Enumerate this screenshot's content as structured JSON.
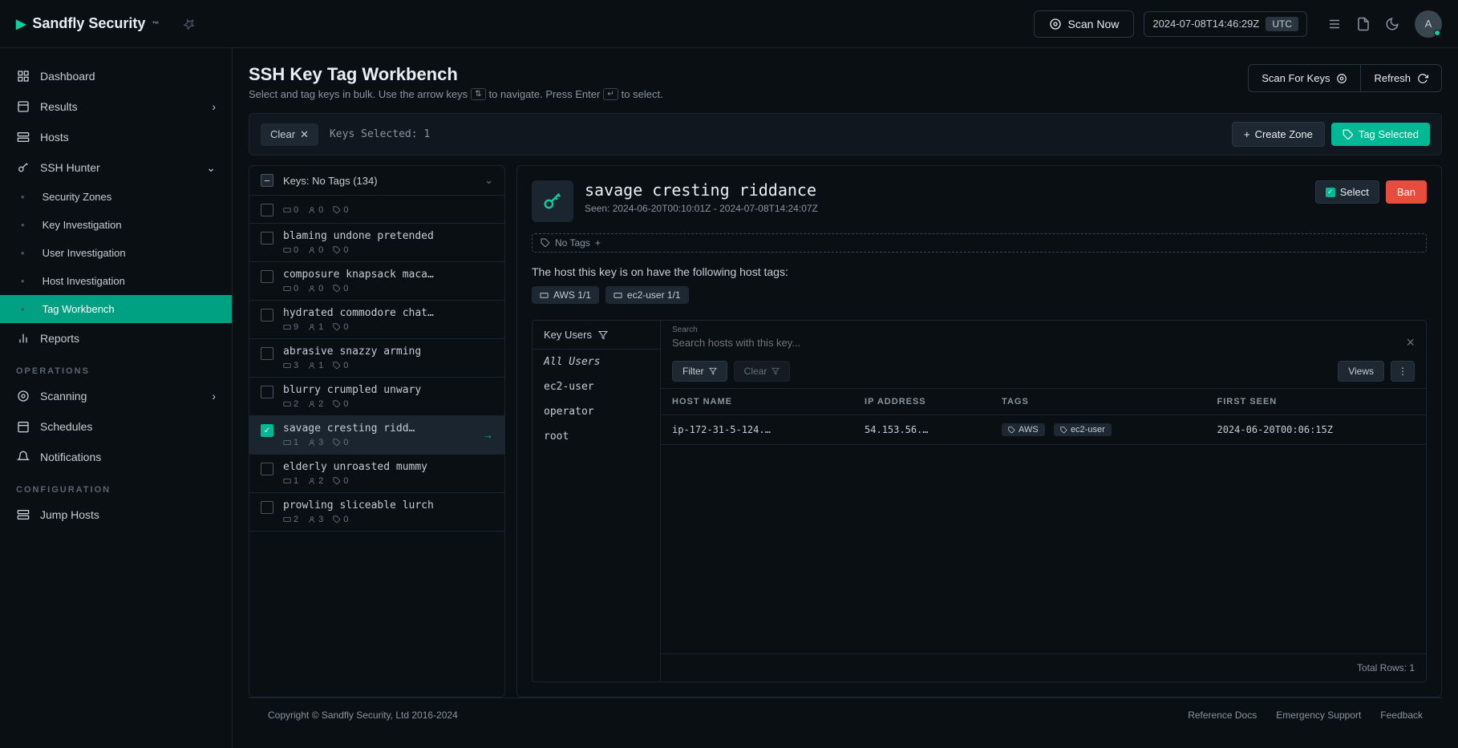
{
  "header": {
    "brand": "Sandfly Security",
    "scan_now": "Scan Now",
    "timestamp": "2024-07-08T14:46:29Z",
    "tz": "UTC",
    "avatar_letter": "A"
  },
  "sidebar": {
    "items": [
      {
        "label": "Dashboard"
      },
      {
        "label": "Results"
      },
      {
        "label": "Hosts"
      },
      {
        "label": "SSH Hunter"
      },
      {
        "label": "Security Zones"
      },
      {
        "label": "Key Investigation"
      },
      {
        "label": "User Investigation"
      },
      {
        "label": "Host Investigation"
      },
      {
        "label": "Tag Workbench"
      },
      {
        "label": "Reports"
      }
    ],
    "operations_label": "OPERATIONS",
    "ops": [
      {
        "label": "Scanning"
      },
      {
        "label": "Schedules"
      },
      {
        "label": "Notifications"
      }
    ],
    "configuration_label": "CONFIGURATION",
    "config": [
      {
        "label": "Jump Hosts"
      }
    ]
  },
  "page": {
    "title": "SSH Key Tag Workbench",
    "subtitle_pre": "Select and tag keys in bulk. Use the arrow keys",
    "subtitle_mid": "to navigate. Press Enter",
    "subtitle_post": "to select.",
    "scan_for_keys": "Scan For Keys",
    "refresh": "Refresh"
  },
  "toolbar": {
    "clear": "Clear",
    "keys_selected": "Keys Selected: 1",
    "create_zone": "Create Zone",
    "tag_selected": "Tag Selected"
  },
  "keylist": {
    "header": "Keys: No Tags (134)",
    "rows": [
      {
        "name": "",
        "h": "0",
        "u": "0",
        "t": "0"
      },
      {
        "name": "blaming undone pretended",
        "h": "0",
        "u": "0",
        "t": "0"
      },
      {
        "name": "composure knapsack maca…",
        "h": "0",
        "u": "0",
        "t": "0"
      },
      {
        "name": "hydrated commodore chat…",
        "h": "9",
        "u": "1",
        "t": "0"
      },
      {
        "name": "abrasive snazzy arming",
        "h": "3",
        "u": "1",
        "t": "0"
      },
      {
        "name": "blurry crumpled unwary",
        "h": "2",
        "u": "2",
        "t": "0"
      },
      {
        "name": "savage cresting ridd…",
        "h": "1",
        "u": "3",
        "t": "0",
        "selected": true
      },
      {
        "name": "elderly unroasted mummy",
        "h": "1",
        "u": "2",
        "t": "0"
      },
      {
        "name": "prowling sliceable lurch",
        "h": "2",
        "u": "3",
        "t": "0"
      }
    ]
  },
  "detail": {
    "title": "savage cresting riddance",
    "seen": "Seen: 2024-06-20T00:10:01Z - 2024-07-08T14:24:07Z",
    "select": "Select",
    "ban": "Ban",
    "no_tags": "No Tags",
    "host_tags_label": "The host this key is on have the following host tags:",
    "host_tags": [
      {
        "label": "AWS 1/1"
      },
      {
        "label": "ec2-user 1/1"
      }
    ],
    "users_header": "Key Users",
    "users": [
      "All Users",
      "ec2-user",
      "operator",
      "root"
    ],
    "search_label": "Search",
    "search_placeholder": "Search hosts with this key...",
    "filter": "Filter",
    "clear_filter": "Clear",
    "views": "Views",
    "columns": [
      "HOST NAME",
      "IP ADDRESS",
      "TAGS",
      "FIRST SEEN"
    ],
    "row": {
      "host": "ip-172-31-5-124.…",
      "ip": "54.153.56.…",
      "tags": [
        "AWS",
        "ec2-user"
      ],
      "first_seen": "2024-06-20T00:06:15Z"
    },
    "total_rows": "Total Rows: 1"
  },
  "footer": {
    "copyright": "Copyright © Sandfly Security, Ltd 2016-2024",
    "links": [
      "Reference Docs",
      "Emergency Support",
      "Feedback"
    ]
  }
}
